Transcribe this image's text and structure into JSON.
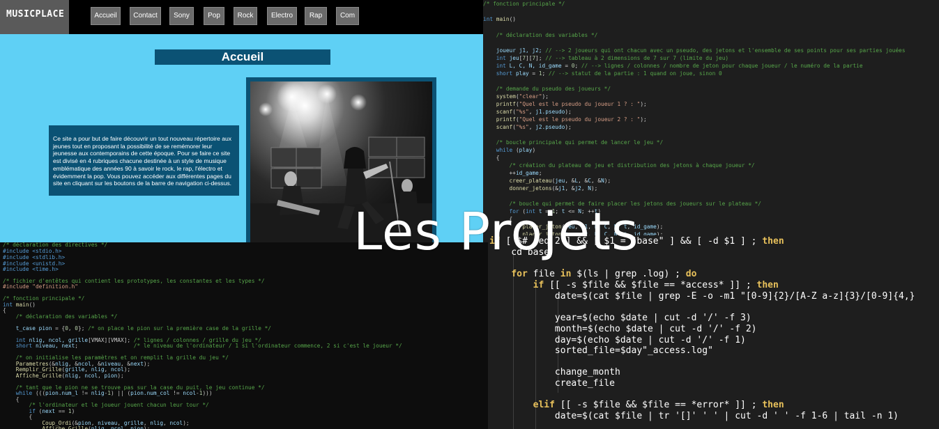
{
  "overlay": {
    "title": "Les Projets"
  },
  "website": {
    "logo": "MUSICPLACE",
    "nav": [
      "Accueil",
      "Contact",
      "Sony",
      "Pop",
      "Rock",
      "Electro",
      "Rap",
      "Com"
    ],
    "page_title": "Accueil",
    "intro_text": "Ce site a pour but de faire découvrir un tout nouveau répertoire aux jeunes tout en proposant la possibilité de se remémorer leur jeunesse aux contemporains de cette époque. Pour se faire ce site est divisé en 4 rubriques chacune destinée à un style de musique emblématique des années 90 à savoir le rock, le rap, l'électro et évidemment la pop. Vous pouvez accéder aux différentes pages du site en cliquant sur les boutons de la barre de navigation ci-dessus."
  },
  "code_c_main": [
    "/* fonction principale */",
    "",
    "int main()",
    "",
    "    /* déclaration des variables */",
    "",
    "    joueur j1, j2; // --> 2 joueurs qui ont chacun avec un pseudo, des jetons et l'ensemble de ses points pour ses parties jouées",
    "    int jeu[7][7]; // --> tableau à 2 dimensions de 7 sur 7 (limite du jeu)",
    "    int L, C, N, id_game = 0; // --> lignes / colonnes / nombre de jeton pour chaque joueur / le numéro de la partie",
    "    short play = 1; // --> statut de la partie : 1 quand on joue, sinon 0",
    "",
    "    /* demande du pseudo des joueurs */",
    "    system(\"clear\");",
    "    printf(\"Quel est le pseudo du joueur 1 ? : \");",
    "    scanf(\"%s\", j1.pseudo);",
    "    printf(\"Quel est le pseudo du joueur 2 ? : \");",
    "    scanf(\"%s\", j2.pseudo);",
    "",
    "    /* boucle principale qui permet de lancer le jeu */",
    "    while (play)",
    "    {",
    "        /* création du plateau de jeu et distribution des jetons à chaque joueur */",
    "        ++id_game;",
    "        creer_plateau(jeu, &L, &C, &N);",
    "        donner_jetons(&j1, &j2, N);",
    "",
    "        /* boucle qui permet de faire placer les jetons des joueurs sur le plateau */",
    "        for (int t = 1; t <= N; ++t)",
    "        {",
    "            placer_jeton(jeu, j1, L, C, N, t, id_game);",
    "            placer_jeton(jeu, j2, L, C, N, t, id_game);"
  ],
  "code_c_game": [
    "/* déclaration des directives */",
    "#include <stdio.h>",
    "#include <stdlib.h>",
    "#include <unistd.h>",
    "#include <time.h>",
    "",
    "/* fichier d'entêtes qui contient les prototypes, les constantes et les types */",
    "#include \"definition.h\"",
    "",
    "/* fonction principale */",
    "int main()",
    "{",
    "    /* déclaration des variables */",
    "",
    "    t_case pion = {0, 0}; /* on place le pion sur la première case de la grille */",
    "",
    "    int nlig, ncol, grille[VMAX][VMAX]; /* lignes / colonnes / grille du jeu */",
    "    short niveau, next;                 /* le niveau de l'ordinateur / 1 si l'ordinateur commence, 2 si c'est le joueur */",
    "",
    "    /* on initialise les paramètres et on remplit la grille du jeu */",
    "    Parametres(&nlig, &ncol, &niveau, &next);",
    "    Remplir_Grille(grille, nlig, ncol);",
    "    Affiche_Grille(nlig, ncol, pion);",
    "",
    "    /* tant que le pion ne se trouve pas sur la case du puit, le jeu continue */",
    "    while (((pion.num_l != nlig-1) || (pion.num_col != ncol-1)))",
    "    {",
    "        /* l'ordinateur et le joueur jouent chacun leur tour */",
    "        if (next == 1)",
    "        {",
    "            Coup_Ordi(&pion, niveau, grille, nlig, ncol);",
    "            Affiche_Grille(nlig, ncol, pion);"
  ],
  "code_bash": [
    "if [ $# -eq 2 ] && [ $1 = \"base\" ] && [ -d $1 ] ; then",
    "    cd base",
    "",
    "    for file in $(ls | grep .log) ; do",
    "        if [[ -s $file && $file == *access* ]] ; then",
    "            date=$(cat $file | grep -E -o -m1 \"[0-9]{2}/[A-Z a-z]{3}/[0-9]{4,}",
    "",
    "            year=$(echo $date | cut -d '/' -f 3)",
    "            month=$(echo $date | cut -d '/' -f 2)",
    "            day=$(echo $date | cut -d '/' -f 1)",
    "            sorted_file=$day\"_access.log\"",
    "",
    "            change_month",
    "            create_file",
    "",
    "        elif [[ -s $file && $file == *error* ]] ; then",
    "            date=$(cat $file | tr '[]' ' ' | cut -d ' ' -f 1-6 | tail -n 1)"
  ]
}
